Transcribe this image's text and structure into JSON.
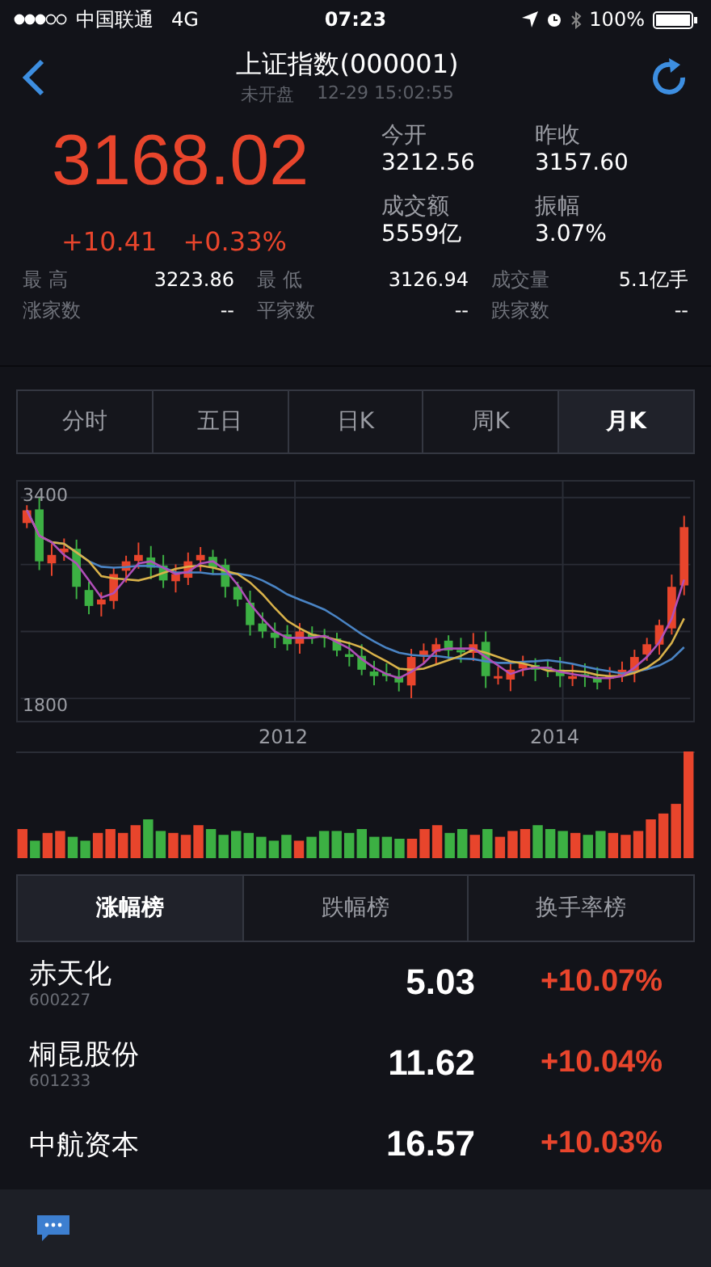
{
  "status_bar": {
    "carrier": "中国联通",
    "network": "4G",
    "time": "07:23",
    "battery": "100%"
  },
  "nav": {
    "title": "上证指数(000001)",
    "market_state": "未开盘",
    "timestamp": "12-29 15:02:55"
  },
  "quote": {
    "price": "3168.02",
    "change": "+10.41",
    "change_pct": "+0.33%",
    "stats": [
      {
        "label": "今开",
        "value": "3212.56"
      },
      {
        "label": "昨收",
        "value": "3157.60"
      },
      {
        "label": "成交额",
        "value": "5559亿"
      },
      {
        "label": "振幅",
        "value": "3.07%"
      }
    ],
    "details": [
      {
        "label": "最 高",
        "value": "3223.86"
      },
      {
        "label": "最 低",
        "value": "3126.94"
      },
      {
        "label": "成交量",
        "value": "5.1亿手"
      },
      {
        "label": "涨家数",
        "value": "--"
      },
      {
        "label": "平家数",
        "value": "--"
      },
      {
        "label": "跌家数",
        "value": "--"
      }
    ]
  },
  "period_tabs": [
    {
      "label": "分时",
      "selected": false
    },
    {
      "label": "五日",
      "selected": false
    },
    {
      "label": "日K",
      "selected": false
    },
    {
      "label": "周K",
      "selected": false
    },
    {
      "label": "月K",
      "selected": true
    }
  ],
  "chart": {
    "y_labels": [
      "3400",
      "1800"
    ],
    "x_labels": [
      "2012",
      "2014"
    ]
  },
  "rank_tabs": [
    {
      "label": "涨幅榜",
      "selected": true
    },
    {
      "label": "跌幅榜",
      "selected": false
    },
    {
      "label": "换手率榜",
      "selected": false
    }
  ],
  "stocks": [
    {
      "name": "赤天化",
      "code": "600227",
      "price": "5.03",
      "change": "+10.07%"
    },
    {
      "name": "桐昆股份",
      "code": "601233",
      "price": "11.62",
      "change": "+10.04%"
    },
    {
      "name": "中航资本",
      "price": "16.57",
      "change": "+10.03%"
    }
  ]
}
